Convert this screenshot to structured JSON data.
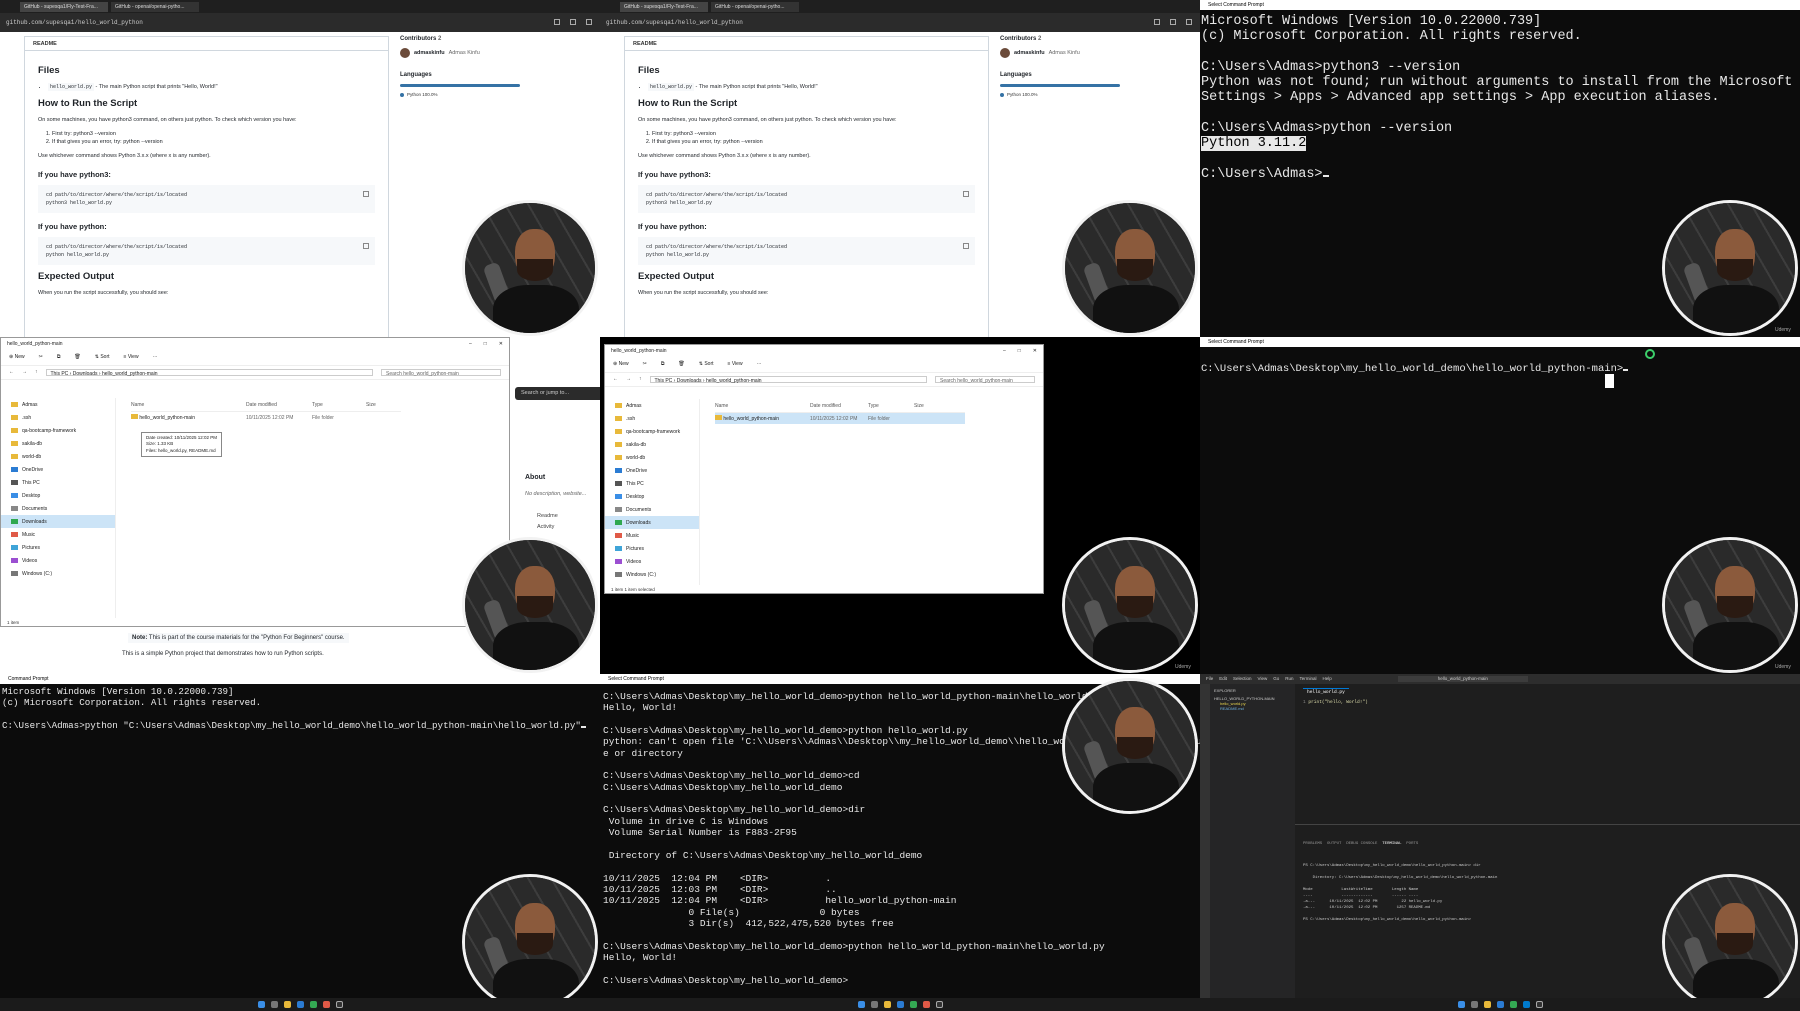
{
  "browser": {
    "tabs": [
      "GitHub - supesqa1/Fly-Test-Fra...",
      "GitHub - openai/openai-pytho..."
    ],
    "url": "github.com/supesqa1/hello_world_python"
  },
  "readme": {
    "header": "README",
    "files_heading": "Files",
    "files_item_code": "hello_world.py",
    "files_item_text": "- The main Python script that prints \"Hello, World!\"",
    "run_heading": "How to Run the Script",
    "run_intro": "On some machines, you have python3 command, on others just python. To check which version you have:",
    "step1": "First try: python3 --version",
    "step2": "If that gives you an error, try: python --version",
    "whichever": "Use whichever command shows Python 3.x.x (where x is any number).",
    "py3_heading": "If you have python3:",
    "py3_code1": "cd path/to/director/where/the/script/is/located",
    "py3_code2": "python3 hello_world.py",
    "py_heading": "If you have python:",
    "py_code1": "cd path/to/director/where/the/script/is/located",
    "py_code2": "python hello_world.py",
    "expected_heading": "Expected Output",
    "expected_text": "When you run the script successfully, you should see:"
  },
  "sidebar": {
    "contributors_label": "Contributors",
    "contributors_count": "2",
    "contributor_login": "admaskinfu",
    "contributor_name": "Admas Kinfu",
    "languages_label": "Languages",
    "language": "Python 100.0%"
  },
  "term1": {
    "title": "Select Command Prompt",
    "lines": [
      "Microsoft Windows [Version 10.0.22000.739]",
      "(c) Microsoft Corporation. All rights reserved.",
      "",
      "C:\\Users\\Admas>python3 --version",
      "Python was not found; run without arguments to install from the Microsoft Store, or disable this shortcut from",
      "Settings > Apps > Advanced app settings > App execution aliases.",
      "",
      "C:\\Users\\Admas>python --version"
    ],
    "version": "Python 3.11.2",
    "prompt": "C:\\Users\\Admas>"
  },
  "explorer": {
    "title": "hello_world_python-main",
    "new": "New",
    "sort": "Sort",
    "view": "View",
    "path": [
      "This PC",
      "Downloads",
      "hello_world_python-main"
    ],
    "search_placeholder": "Search hello_world_python-main",
    "nav": [
      "Admas",
      ".ssh",
      "qa-bootcamp-framework",
      "sakila-db",
      "world-db",
      "OneDrive",
      "This PC",
      "Desktop",
      "Documents",
      "Downloads",
      "Music",
      "Pictures",
      "Videos",
      "Windows (C:)"
    ],
    "columns": [
      "Name",
      "Date modified",
      "Type",
      "Size"
    ],
    "row": {
      "name": "hello_world_python-main",
      "date": "10/11/2025 12:02 PM",
      "type": "File folder"
    },
    "tooltip": [
      "Date created: 10/11/2025 12:02 PM",
      "Size: 1.33 KB",
      "Files: hello_world.py, README.md"
    ],
    "status": "1 item",
    "status2": "1 item selected"
  },
  "github_under": {
    "search": "Search or jump to...",
    "about": "About",
    "about_desc": "No description, website...",
    "readme_link": "Readme",
    "activity": "Activity",
    "note_label": "Note:",
    "note_text": "This is part of the course materials for the \"Python For Beginners\" course.",
    "simple": "This is a simple Python project that demonstrates how to run Python scripts."
  },
  "term6": {
    "title": "Select Command Prompt",
    "prompt": "C:\\Users\\Admas\\Desktop\\my_hello_world_demo\\hello_world_python-main>"
  },
  "term7": {
    "title": "Command Prompt",
    "lines": [
      "Microsoft Windows [Version 10.0.22000.739]",
      "(c) Microsoft Corporation. All rights reserved.",
      "",
      "C:\\Users\\Admas>python \"C:\\Users\\Admas\\Desktop\\my_hello_world_demo\\hello_world_python-main\\hello_world.py\""
    ]
  },
  "term8": {
    "title": "Select Command Prompt",
    "lines": [
      "C:\\Users\\Admas\\Desktop\\my_hello_world_demo>python hello_world_python-main\\hello_world.py",
      "Hello, World!",
      "",
      "C:\\Users\\Admas\\Desktop\\my_hello_world_demo>python hello_world.py",
      "python: can't open file 'C:\\\\Users\\\\Admas\\\\Desktop\\\\my_hello_world_demo\\\\hello_world.py': [Errno 2] No such fil",
      "e or directory",
      "",
      "C:\\Users\\Admas\\Desktop\\my_hello_world_demo>cd",
      "C:\\Users\\Admas\\Desktop\\my_hello_world_demo",
      "",
      "C:\\Users\\Admas\\Desktop\\my_hello_world_demo>dir",
      " Volume in drive C is Windows",
      " Volume Serial Number is F883-2F95",
      "",
      " Directory of C:\\Users\\Admas\\Desktop\\my_hello_world_demo",
      "",
      "10/11/2025  12:04 PM    <DIR>          .",
      "10/11/2025  12:03 PM    <DIR>          ..",
      "10/11/2025  12:04 PM    <DIR>          hello_world_python-main",
      "               0 File(s)              0 bytes",
      "               3 Dir(s)  412,522,475,520 bytes free",
      "",
      "C:\\Users\\Admas\\Desktop\\my_hello_world_demo>python hello_world_python-main\\hello_world.py",
      "Hello, World!",
      "",
      "C:\\Users\\Admas\\Desktop\\my_hello_world_demo>"
    ]
  },
  "vscode": {
    "menu": [
      "File",
      "Edit",
      "Selection",
      "View",
      "Go",
      "Run",
      "Terminal",
      "Help"
    ],
    "title": "hello_world_python-main",
    "explorer_label": "EXPLORER",
    "folder": "HELLO_WORLD_PYTHON-MAIN",
    "files": [
      "hello_world.py",
      "README.md"
    ],
    "tab": "hello_world.py",
    "code": "print(\"hello, World!\")",
    "panel_tabs": [
      "PROBLEMS",
      "OUTPUT",
      "DEBUG CONSOLE",
      "TERMINAL",
      "PORTS"
    ],
    "panel_lines": [
      "PS C:\\Users\\Admas\\Desktop\\my_hello_world_demo\\hello_world_python-main> dir",
      "",
      "    Directory: C:\\Users\\Admas\\Desktop\\my_hello_world_demo\\hello_world_python-main",
      "",
      "Mode            LastWriteTime        Length Name",
      "----            -------------        ------ ----",
      "-a---      10/11/2025  12:02 PM          22 hello_world.py",
      "-a---      10/11/2025  12:02 PM        1257 README.md",
      "",
      "PS C:\\Users\\Admas\\Desktop\\my_hello_world_demo\\hello_world_python-main> "
    ]
  },
  "watermark": "Udemy",
  "colors": {
    "accent": "#0078d4",
    "python": "#3572a5",
    "terminal_bg": "#0c0c0c"
  }
}
